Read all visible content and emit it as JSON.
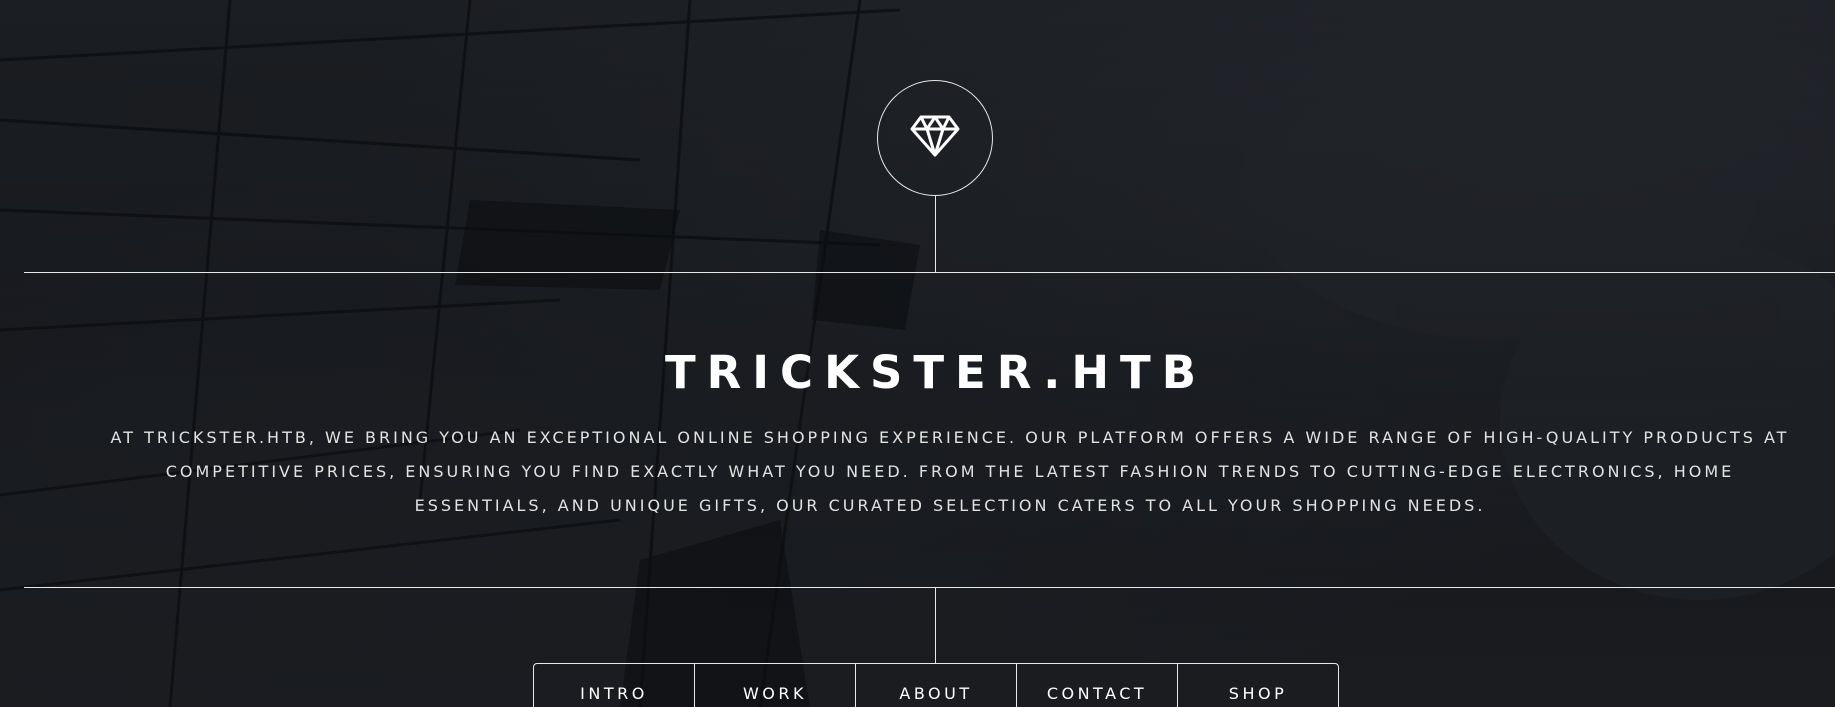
{
  "header": {
    "logo_icon": "diamond-icon",
    "title": "TRICKSTER.HTB",
    "description": "AT TRICKSTER.HTB, WE BRING YOU AN EXCEPTIONAL ONLINE SHOPPING EXPERIENCE. OUR PLATFORM OFFERS A WIDE RANGE OF HIGH-QUALITY PRODUCTS AT COMPETITIVE PRICES, ENSURING YOU FIND EXACTLY WHAT YOU NEED. FROM THE LATEST FASHION TRENDS TO CUTTING-EDGE ELECTRONICS, HOME ESSENTIALS, AND UNIQUE GIFTS, OUR CURATED SELECTION CATERS TO ALL YOUR SHOPPING NEEDS."
  },
  "nav": {
    "items": [
      {
        "label": "INTRO"
      },
      {
        "label": "WORK"
      },
      {
        "label": "ABOUT"
      },
      {
        "label": "CONTACT"
      },
      {
        "label": "SHOP"
      }
    ]
  },
  "colors": {
    "background": "#16181c",
    "line": "#e8e8e8",
    "text": "#ffffff"
  }
}
